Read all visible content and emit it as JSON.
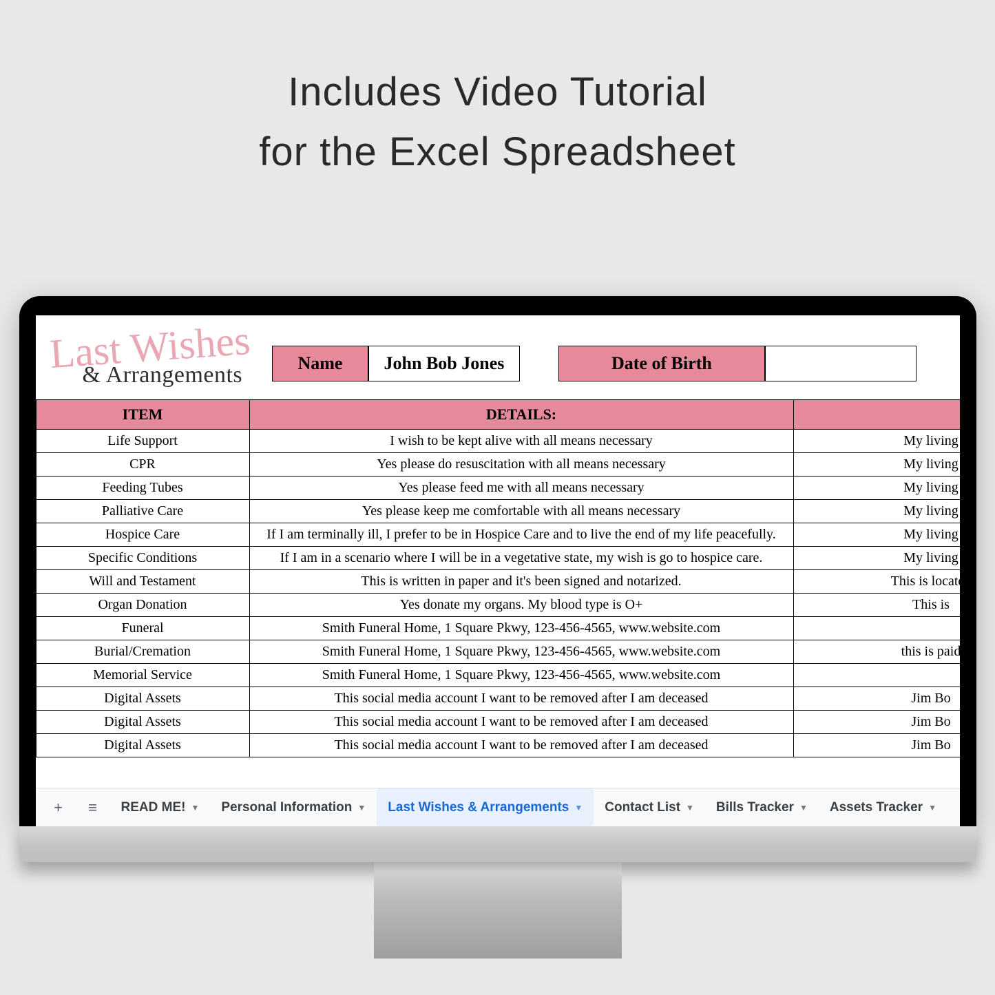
{
  "heading": {
    "line1": "Includes Video Tutorial",
    "line2": "for the Excel Spreadsheet"
  },
  "logo": {
    "top": "Last Wishes",
    "bottom": "& Arrangements"
  },
  "header_fields": {
    "name_label": "Name",
    "name_value": "John Bob Jones",
    "dob_label": "Date of Birth",
    "dob_value": ""
  },
  "columns": {
    "item": "ITEM",
    "details": "DETAILS:",
    "extra": ""
  },
  "rows": [
    {
      "item": "Life Support",
      "details": "I wish to be kept alive with all means necessary",
      "extra": "My living "
    },
    {
      "item": "CPR",
      "details": "Yes please do resuscitation with all means necessary",
      "extra": "My living "
    },
    {
      "item": "Feeding Tubes",
      "details": "Yes please feed me with all means necessary",
      "extra": "My living "
    },
    {
      "item": "Palliative Care",
      "details": "Yes please keep me comfortable with all means necessary",
      "extra": "My living "
    },
    {
      "item": "Hospice Care",
      "details": "If I am terminally ill, I prefer to be in Hospice Care and to live the end of my life peacefully.",
      "extra": "My living "
    },
    {
      "item": "Specific Conditions",
      "details": "If I am in a scenario where I will be in a vegetative state, my wish is go to hospice care.",
      "extra": "My living "
    },
    {
      "item": "Will and Testament",
      "details": "This is written in paper and it's been signed and notarized.",
      "extra": "This is located"
    },
    {
      "item": "Organ Donation",
      "details": "Yes donate my organs. My blood type is O+",
      "extra": "This is "
    },
    {
      "item": "Funeral",
      "details": "Smith Funeral Home, 1 Square Pkwy, 123-456-4565, www.website.com",
      "extra": ""
    },
    {
      "item": "Burial/Cremation",
      "details": "Smith Funeral Home, 1 Square Pkwy, 123-456-4565, www.website.com",
      "extra": "this is paid "
    },
    {
      "item": "Memorial Service",
      "details": "Smith Funeral Home, 1 Square Pkwy, 123-456-4565, www.website.com",
      "extra": ""
    },
    {
      "item": "Digital Assets",
      "details": "This social media account I want to be removed after I am deceased",
      "extra": "Jim Bo"
    },
    {
      "item": "Digital Assets",
      "details": "This social media account I want to be removed after I am deceased",
      "extra": "Jim Bo"
    },
    {
      "item": "Digital Assets",
      "details": "This social media account I want to be removed after I am deceased",
      "extra": "Jim Bo"
    }
  ],
  "tabs": [
    {
      "label": "READ ME!",
      "active": false
    },
    {
      "label": "Personal Information",
      "active": false
    },
    {
      "label": "Last Wishes & Arrangements",
      "active": true
    },
    {
      "label": "Contact List",
      "active": false
    },
    {
      "label": "Bills Tracker",
      "active": false
    },
    {
      "label": "Assets Tracker",
      "active": false
    }
  ]
}
